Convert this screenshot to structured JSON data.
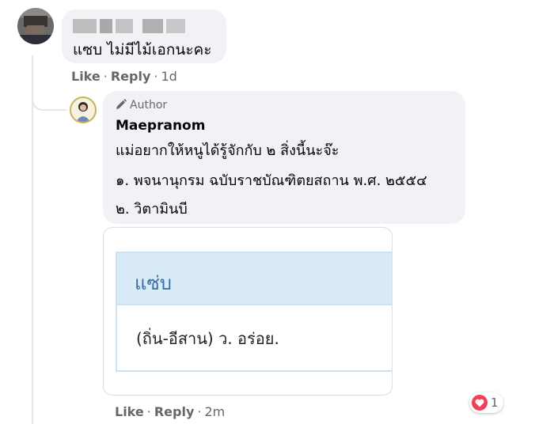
{
  "comment": {
    "text": "แซบ ไม่มีไม้เอกนะคะ",
    "actions": {
      "like": "Like",
      "reply": "Reply",
      "age": "1d"
    }
  },
  "reply": {
    "badge": "Author",
    "author": "Maepranom",
    "lines": [
      "แม่อยากให้หนูได้รู้จักกับ ๒ สิ่งนี้นะจ๊ะ",
      "๑. พจนานุกรม ฉบับราชบัณฑิตยสถาน พ.ศ. ๒๕๕๔",
      "๒. วิตามินบี"
    ],
    "card": {
      "word": "แซ่บ",
      "definition": "(ถิ่น-อีสาน) ว. อร่อย."
    },
    "reaction_count": "1",
    "actions": {
      "like": "Like",
      "reply": "Reply",
      "age": "2m"
    }
  },
  "icons": [
    "pencil-icon",
    "heart-icon"
  ],
  "colors": {
    "bubble": "#f0f2f5",
    "meta": "#65676b",
    "dict_header": "#d9ebf7",
    "dict_word": "#3b6ea5",
    "heart": "#f33e58"
  }
}
